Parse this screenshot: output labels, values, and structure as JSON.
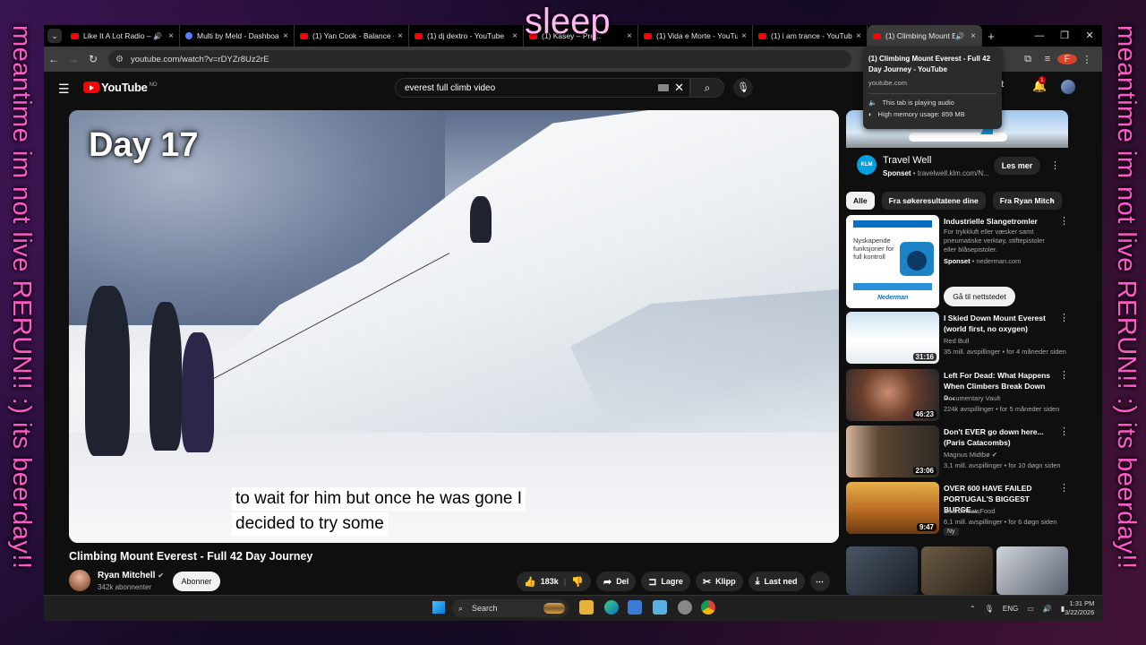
{
  "overlay": {
    "title": "sleep",
    "left_text": "meantime im not live RERUN!! :) its beerday!!",
    "right_text": "meantime im not live RERUN!! :) its beerday!!"
  },
  "tabs": [
    {
      "title": "Like It A Lot Radio – Y",
      "audio": true
    },
    {
      "title": "Multi by Meld - Dashboa",
      "audio": false
    },
    {
      "title": "(1) Yan Cook - Balance - Y",
      "audio": false
    },
    {
      "title": "(1) dj dextro - YouTube",
      "audio": false
    },
    {
      "title": "(1) Kasey – Pre...",
      "audio": false
    },
    {
      "title": "(1) Vida e Morte - YouTub",
      "audio": false
    },
    {
      "title": "(1) i am trance - YouTube",
      "audio": false
    },
    {
      "title": "(1) Climbing Mount E",
      "audio": true
    }
  ],
  "browser": {
    "url": "youtube.com/watch?v=rDYZr8Uz2rE",
    "profile_initial": "F"
  },
  "tooltip": {
    "title": "(1) Climbing Mount Everest - Full 42 Day Journey - YouTube",
    "url": "youtube.com",
    "audio": "This tab is playing audio",
    "memory": "High memory usage: 859 MB"
  },
  "youtube": {
    "logo": "YouTube",
    "logo_country": "NO",
    "search_query": "everest full climb video",
    "header_right": "ett",
    "notif_count": "1"
  },
  "video": {
    "overlay_label": "Day 17",
    "caption_line1": "to wait for him but once he was gone I",
    "caption_line2": "decided to try some",
    "title": "Climbing Mount Everest - Full 42 Day Journey",
    "channel": "Ryan Mitchell",
    "subs": "342k abonnenter",
    "subscribe": "Abonner",
    "likes": "183k",
    "share": "Del",
    "save": "Lagre",
    "clip": "Klipp",
    "download": "Last ned"
  },
  "ad_top": {
    "title": "Travel Well",
    "sponsored": "Sponset",
    "domain": "travelwell.klm.com/N...",
    "cta": "Les mer",
    "logo": "KLM"
  },
  "chips": [
    "Alle",
    "Fra søkeresultatene dine",
    "Fra Ryan Mitch"
  ],
  "ad_second": {
    "title": "Industrielle Slangetromler",
    "desc": "For trykkluft eller væsker samt pneumatiske verktøy, stiftepistoler eller blåsepistoler.",
    "sponsored": "Sponset",
    "domain": "nederman.com",
    "cta": "Gå til nettstedet",
    "thumb_text": "Nyskapende funksjoner for full kontroll",
    "brand": "Nederman"
  },
  "recommendations": [
    {
      "title": "I Skied Down Mount Everest (world first, no oxygen)",
      "channel": "Red Bull",
      "meta": "35 mill. avspillinger • for 4 måneder siden",
      "duration": "31:16"
    },
    {
      "title": "Left For Dead: What Happens When Climbers Break Down o...",
      "channel": "Documentary Vault",
      "meta": "224k avspillinger • for 5 måneder siden",
      "duration": "46:23"
    },
    {
      "title": "Don't EVER go down here... (Paris Catacombs)",
      "channel": "Magnus Midtbø",
      "meta": "3,1 mill. avspillinger • for 10 døgn siden",
      "duration": "23:06"
    },
    {
      "title": "OVER 600 HAVE FAILED PORTUGAL'S BIGGEST BURGE...",
      "channel": "BeardMeatsFood",
      "meta": "6,1 mill. avspillinger • for 6 døgn siden",
      "duration": "9:47",
      "badge": "Ny"
    }
  ],
  "taskbar": {
    "search": "Search",
    "lang": "ENG",
    "time": "1:31 PM",
    "date": "3/22/2026"
  }
}
